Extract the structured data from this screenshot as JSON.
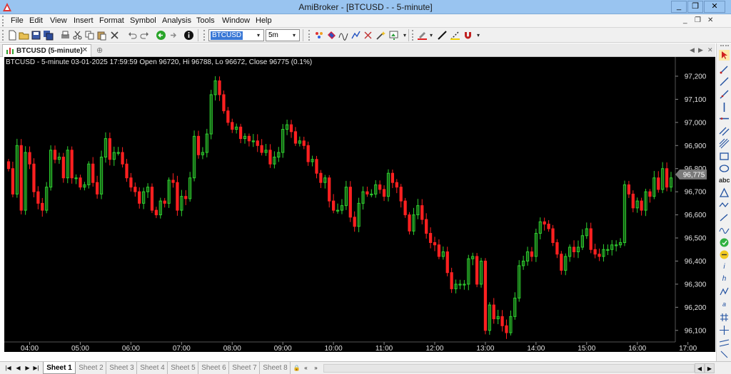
{
  "window": {
    "title": "AmiBroker - [BTCUSD -  - 5-minute]",
    "minimize": "_",
    "restore": "❐",
    "close": "✕"
  },
  "menu": [
    "File",
    "Edit",
    "View",
    "Insert",
    "Format",
    "Symbol",
    "Analysis",
    "Tools",
    "Window",
    "Help"
  ],
  "mdi_buttons": [
    "_",
    "❐",
    "✕"
  ],
  "toolbar": {
    "symbol": "BTCUSD",
    "interval": "5m"
  },
  "chart_tab": {
    "label": "BTCUSD (5-minute)",
    "close": "✕"
  },
  "chart_info": "BTCUSD - 5-minute 03-01-2025 17:59:59 Open 96720, Hi 96788, Lo 96672, Close 96775 (0.1%)",
  "colors": {
    "up": "#2fd12f",
    "down": "#ff2020",
    "background": "#000000",
    "axis_text": "#e0e0e0",
    "price_tag": "#7a7a7a"
  },
  "sheets": [
    "Sheet 1",
    "Sheet 2",
    "Sheet 3",
    "Sheet 4",
    "Sheet 5",
    "Sheet 6",
    "Sheet 7",
    "Sheet 8"
  ],
  "active_sheet": "Sheet 1",
  "chart_data": {
    "type": "candlestick",
    "title": "",
    "y_ticks": [
      97200,
      97100,
      97000,
      96900,
      96800,
      96700,
      96600,
      96500,
      96400,
      96300,
      96200,
      96100
    ],
    "y_tick_labels": [
      "97,200",
      "97,100",
      "97,000",
      "96,900",
      "96,800",
      "96,700",
      "96,600",
      "96,500",
      "96,400",
      "96,300",
      "96,200",
      "96,100"
    ],
    "ylim": [
      96050,
      97240
    ],
    "x_tick_labels": [
      "04:00",
      "05:00",
      "06:00",
      "07:00",
      "08:00",
      "09:00",
      "10:00",
      "11:00",
      "12:00",
      "13:00",
      "14:00",
      "15:00",
      "16:00",
      "17:00"
    ],
    "x_tick_hours": [
      4,
      5,
      6,
      7,
      8,
      9,
      10,
      11,
      12,
      13,
      14,
      15,
      16,
      17
    ],
    "start_time": "03:35",
    "bar_minutes": 5,
    "last_price_label": "96,775",
    "last_price": 96775,
    "closes": [
      96800,
      96690,
      96900,
      96620,
      96870,
      96820,
      96700,
      96650,
      96620,
      96720,
      96880,
      96840,
      96850,
      96760,
      96880,
      96760,
      96760,
      96720,
      96730,
      96820,
      96740,
      96690,
      96850,
      96930,
      96840,
      96870,
      96870,
      96820,
      96760,
      96720,
      96700,
      96650,
      96700,
      96720,
      96620,
      96600,
      96660,
      96650,
      96750,
      96740,
      96620,
      96680,
      96670,
      96760,
      96940,
      96860,
      96870,
      96950,
      97120,
      97180,
      97120,
      97050,
      97000,
      96970,
      96980,
      96930,
      96940,
      96920,
      96920,
      96900,
      96870,
      96880,
      96820,
      96850,
      96870,
      96970,
      96990,
      96960,
      96910,
      96920,
      96900,
      96830,
      96840,
      96780,
      96740,
      96760,
      96660,
      96620,
      96620,
      96640,
      96720,
      96590,
      96550,
      96650,
      96700,
      96690,
      96690,
      96730,
      96710,
      96680,
      96780,
      96740,
      96720,
      96660,
      96600,
      96530,
      96600,
      96640,
      96580,
      96520,
      96480,
      96470,
      96420,
      96440,
      96350,
      96280,
      96300,
      96300,
      96300,
      96410,
      96420,
      96300,
      96400,
      96100,
      96210,
      96150,
      96160,
      96120,
      96090,
      96160,
      96240,
      96380,
      96400,
      96440,
      96420,
      96520,
      96570,
      96560,
      96540,
      96480,
      96430,
      96360,
      96420,
      96460,
      96440,
      96460,
      96510,
      96540,
      96450,
      96430,
      96420,
      96450,
      96450,
      96470,
      96470,
      96480,
      96730,
      96690,
      96630,
      96660,
      96620,
      96700,
      96680,
      96760,
      96710,
      96800,
      96720,
      96760
    ]
  }
}
